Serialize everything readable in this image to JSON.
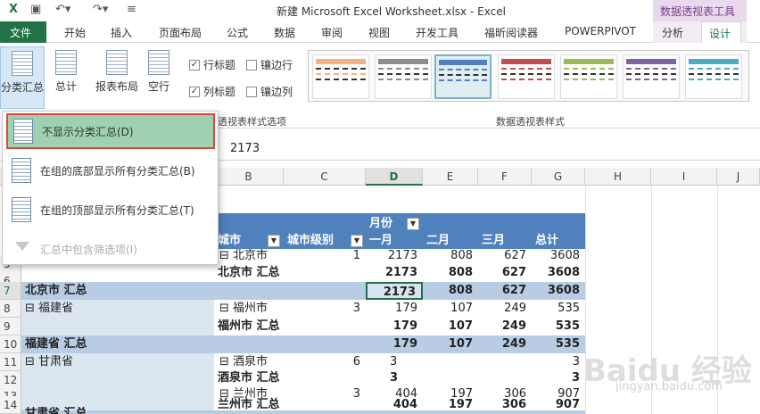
{
  "window": {
    "title": "新建 Microsoft Excel Worksheet.xlsx - Excel",
    "context_tools": "数据透视表工具"
  },
  "tabs": {
    "file": "文件",
    "items": [
      "开始",
      "插入",
      "页面布局",
      "公式",
      "数据",
      "审阅",
      "视图",
      "开发工具",
      "福昕阅读器",
      "POWERPIVOT",
      "分析",
      "设计"
    ],
    "active": "设计"
  },
  "ribbon": {
    "buttons": [
      "分类汇总",
      "总计",
      "报表布局",
      "空行"
    ],
    "checks": [
      {
        "label": "行标题",
        "checked": true
      },
      {
        "label": "镶边行",
        "checked": false
      },
      {
        "label": "列标题",
        "checked": true
      },
      {
        "label": "镶边列",
        "checked": false
      }
    ],
    "group_options": "透视表样式选项",
    "group_styles": "数据透视表样式"
  },
  "formula": {
    "value": "2173"
  },
  "dropdown": {
    "items": [
      "不显示分类汇总(D)",
      "在组的底部显示所有分类汇总(B)",
      "在组的顶部显示所有分类汇总(T)",
      "汇总中包含筛选项(I)"
    ]
  },
  "columns": [
    "B",
    "C",
    "D",
    "E",
    "F",
    "G",
    "H",
    "I",
    "J"
  ],
  "rows": [
    "5",
    "6",
    "7",
    "8",
    "9",
    "10",
    "11",
    "12",
    "13",
    "14"
  ],
  "pivot": {
    "month_header": "月份",
    "city_header": "城市",
    "level_header": "城市级别",
    "months": [
      "一月",
      "二月",
      "三月",
      "总计"
    ],
    "r5": {
      "city": "北京市",
      "level": "1",
      "v": [
        "2173",
        "808",
        "627",
        "3608"
      ]
    },
    "r6": {
      "city": "北京市 汇总",
      "v": [
        "2173",
        "808",
        "627",
        "3608"
      ]
    },
    "r7": {
      "label": "北京市 汇总",
      "v": [
        "2173",
        "808",
        "627",
        "3608"
      ]
    },
    "r8": {
      "prov": "福建省",
      "city": "福州市",
      "level": "3",
      "v": [
        "179",
        "107",
        "249",
        "535"
      ]
    },
    "r9": {
      "city": "福州市 汇总",
      "v": [
        "179",
        "107",
        "249",
        "535"
      ]
    },
    "r10": {
      "label": "福建省 汇总",
      "v": [
        "179",
        "107",
        "249",
        "535"
      ]
    },
    "r11": {
      "prov": "甘肃省",
      "city": "酒泉市",
      "level": "6",
      "v": [
        "3",
        "",
        "",
        "3"
      ]
    },
    "r12": {
      "city": "酒泉市 汇总",
      "v": [
        "3",
        "",
        "",
        "3"
      ]
    },
    "r13": {
      "city": "兰州市",
      "level": "3",
      "v": [
        "404",
        "197",
        "306",
        "907"
      ]
    },
    "r14": {
      "city": "兰州市 汇总",
      "v": [
        "404",
        "197",
        "306",
        "907"
      ]
    },
    "r15_label": "甘肃省 汇总"
  },
  "watermark": {
    "text": "Baidu 经验",
    "sub": "jingyan.baidu.com"
  }
}
